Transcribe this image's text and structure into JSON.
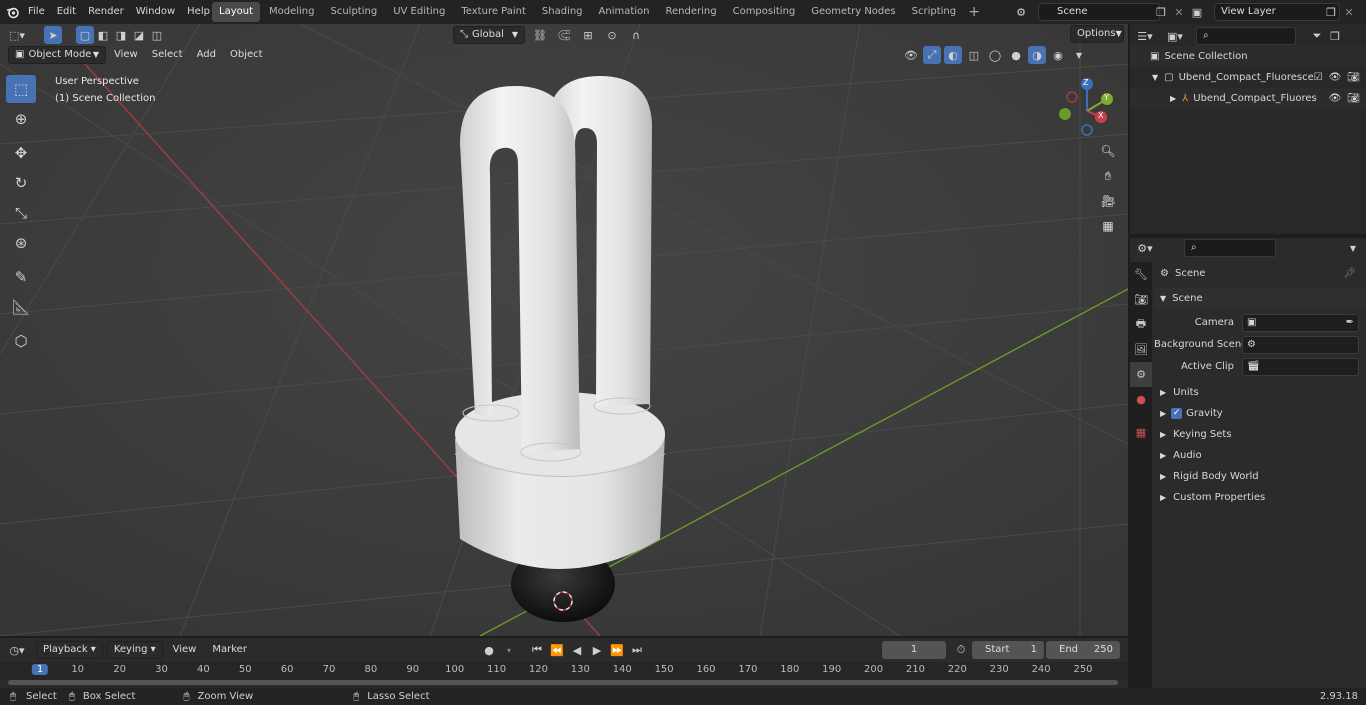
{
  "topbar": {
    "menus": [
      "File",
      "Edit",
      "Render",
      "Window",
      "Help"
    ],
    "workspaces": [
      "Layout",
      "Modeling",
      "Sculpting",
      "UV Editing",
      "Texture Paint",
      "Shading",
      "Animation",
      "Rendering",
      "Compositing",
      "Geometry Nodes",
      "Scripting"
    ],
    "active_workspace": "Layout",
    "scene_name": "Scene",
    "view_layer": "View Layer"
  },
  "viewport": {
    "mode": "Object Mode",
    "menus": [
      "View",
      "Select",
      "Add",
      "Object"
    ],
    "transform_orientation": "Global",
    "options_label": "Options",
    "perspective_label": "User Perspective",
    "collection_label": "(1) Scene Collection",
    "gizmo_axes": [
      "Z",
      "Y",
      "X"
    ]
  },
  "outliner": {
    "root": "Scene Collection",
    "items": [
      {
        "label": "Ubend_Compact_Fluorescent"
      },
      {
        "label": "Ubend_Compact_Fluores"
      }
    ]
  },
  "properties": {
    "context_title": "Scene",
    "panel_title": "Scene",
    "fields": [
      {
        "label": "Camera"
      },
      {
        "label": "Background Scene"
      },
      {
        "label": "Active Clip"
      }
    ],
    "subpanels": [
      "Units",
      "Gravity",
      "Keying Sets",
      "Audio",
      "Rigid Body World",
      "Custom Properties"
    ]
  },
  "timeline": {
    "menus": [
      "Playback",
      "Keying",
      "View",
      "Marker"
    ],
    "current_frame": "1",
    "start_label": "Start",
    "start_value": "1",
    "end_label": "End",
    "end_value": "250",
    "ticks": [
      "1",
      "10",
      "20",
      "30",
      "40",
      "50",
      "60",
      "70",
      "80",
      "90",
      "100",
      "110",
      "120",
      "130",
      "140",
      "150",
      "160",
      "170",
      "180",
      "190",
      "200",
      "210",
      "220",
      "230",
      "240",
      "250"
    ]
  },
  "statusbar": {
    "items": [
      "Select",
      "Box Select",
      "Zoom View",
      "Lasso Select"
    ],
    "version": "2.93.18"
  }
}
